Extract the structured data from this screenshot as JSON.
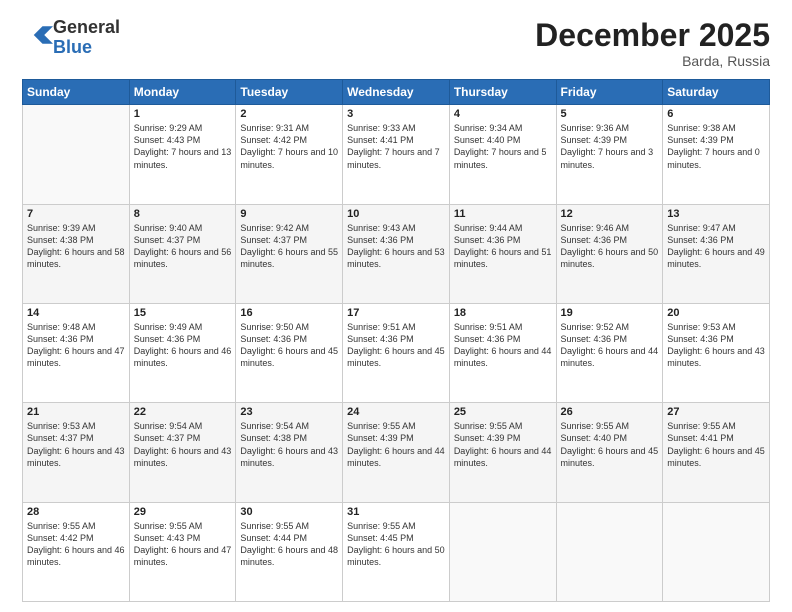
{
  "header": {
    "logo_general": "General",
    "logo_blue": "Blue",
    "month_year": "December 2025",
    "location": "Barda, Russia"
  },
  "days_of_week": [
    "Sunday",
    "Monday",
    "Tuesday",
    "Wednesday",
    "Thursday",
    "Friday",
    "Saturday"
  ],
  "weeks": [
    [
      {
        "day": "",
        "info": ""
      },
      {
        "day": "1",
        "info": "Sunrise: 9:29 AM\nSunset: 4:43 PM\nDaylight: 7 hours\nand 13 minutes."
      },
      {
        "day": "2",
        "info": "Sunrise: 9:31 AM\nSunset: 4:42 PM\nDaylight: 7 hours\nand 10 minutes."
      },
      {
        "day": "3",
        "info": "Sunrise: 9:33 AM\nSunset: 4:41 PM\nDaylight: 7 hours\nand 7 minutes."
      },
      {
        "day": "4",
        "info": "Sunrise: 9:34 AM\nSunset: 4:40 PM\nDaylight: 7 hours\nand 5 minutes."
      },
      {
        "day": "5",
        "info": "Sunrise: 9:36 AM\nSunset: 4:39 PM\nDaylight: 7 hours\nand 3 minutes."
      },
      {
        "day": "6",
        "info": "Sunrise: 9:38 AM\nSunset: 4:39 PM\nDaylight: 7 hours\nand 0 minutes."
      }
    ],
    [
      {
        "day": "7",
        "info": "Sunrise: 9:39 AM\nSunset: 4:38 PM\nDaylight: 6 hours\nand 58 minutes."
      },
      {
        "day": "8",
        "info": "Sunrise: 9:40 AM\nSunset: 4:37 PM\nDaylight: 6 hours\nand 56 minutes."
      },
      {
        "day": "9",
        "info": "Sunrise: 9:42 AM\nSunset: 4:37 PM\nDaylight: 6 hours\nand 55 minutes."
      },
      {
        "day": "10",
        "info": "Sunrise: 9:43 AM\nSunset: 4:36 PM\nDaylight: 6 hours\nand 53 minutes."
      },
      {
        "day": "11",
        "info": "Sunrise: 9:44 AM\nSunset: 4:36 PM\nDaylight: 6 hours\nand 51 minutes."
      },
      {
        "day": "12",
        "info": "Sunrise: 9:46 AM\nSunset: 4:36 PM\nDaylight: 6 hours\nand 50 minutes."
      },
      {
        "day": "13",
        "info": "Sunrise: 9:47 AM\nSunset: 4:36 PM\nDaylight: 6 hours\nand 49 minutes."
      }
    ],
    [
      {
        "day": "14",
        "info": "Sunrise: 9:48 AM\nSunset: 4:36 PM\nDaylight: 6 hours\nand 47 minutes."
      },
      {
        "day": "15",
        "info": "Sunrise: 9:49 AM\nSunset: 4:36 PM\nDaylight: 6 hours\nand 46 minutes."
      },
      {
        "day": "16",
        "info": "Sunrise: 9:50 AM\nSunset: 4:36 PM\nDaylight: 6 hours\nand 45 minutes."
      },
      {
        "day": "17",
        "info": "Sunrise: 9:51 AM\nSunset: 4:36 PM\nDaylight: 6 hours\nand 45 minutes."
      },
      {
        "day": "18",
        "info": "Sunrise: 9:51 AM\nSunset: 4:36 PM\nDaylight: 6 hours\nand 44 minutes."
      },
      {
        "day": "19",
        "info": "Sunrise: 9:52 AM\nSunset: 4:36 PM\nDaylight: 6 hours\nand 44 minutes."
      },
      {
        "day": "20",
        "info": "Sunrise: 9:53 AM\nSunset: 4:36 PM\nDaylight: 6 hours\nand 43 minutes."
      }
    ],
    [
      {
        "day": "21",
        "info": "Sunrise: 9:53 AM\nSunset: 4:37 PM\nDaylight: 6 hours\nand 43 minutes."
      },
      {
        "day": "22",
        "info": "Sunrise: 9:54 AM\nSunset: 4:37 PM\nDaylight: 6 hours\nand 43 minutes."
      },
      {
        "day": "23",
        "info": "Sunrise: 9:54 AM\nSunset: 4:38 PM\nDaylight: 6 hours\nand 43 minutes."
      },
      {
        "day": "24",
        "info": "Sunrise: 9:55 AM\nSunset: 4:39 PM\nDaylight: 6 hours\nand 44 minutes."
      },
      {
        "day": "25",
        "info": "Sunrise: 9:55 AM\nSunset: 4:39 PM\nDaylight: 6 hours\nand 44 minutes."
      },
      {
        "day": "26",
        "info": "Sunrise: 9:55 AM\nSunset: 4:40 PM\nDaylight: 6 hours\nand 45 minutes."
      },
      {
        "day": "27",
        "info": "Sunrise: 9:55 AM\nSunset: 4:41 PM\nDaylight: 6 hours\nand 45 minutes."
      }
    ],
    [
      {
        "day": "28",
        "info": "Sunrise: 9:55 AM\nSunset: 4:42 PM\nDaylight: 6 hours\nand 46 minutes."
      },
      {
        "day": "29",
        "info": "Sunrise: 9:55 AM\nSunset: 4:43 PM\nDaylight: 6 hours\nand 47 minutes."
      },
      {
        "day": "30",
        "info": "Sunrise: 9:55 AM\nSunset: 4:44 PM\nDaylight: 6 hours\nand 48 minutes."
      },
      {
        "day": "31",
        "info": "Sunrise: 9:55 AM\nSunset: 4:45 PM\nDaylight: 6 hours\nand 50 minutes."
      },
      {
        "day": "",
        "info": ""
      },
      {
        "day": "",
        "info": ""
      },
      {
        "day": "",
        "info": ""
      }
    ]
  ]
}
